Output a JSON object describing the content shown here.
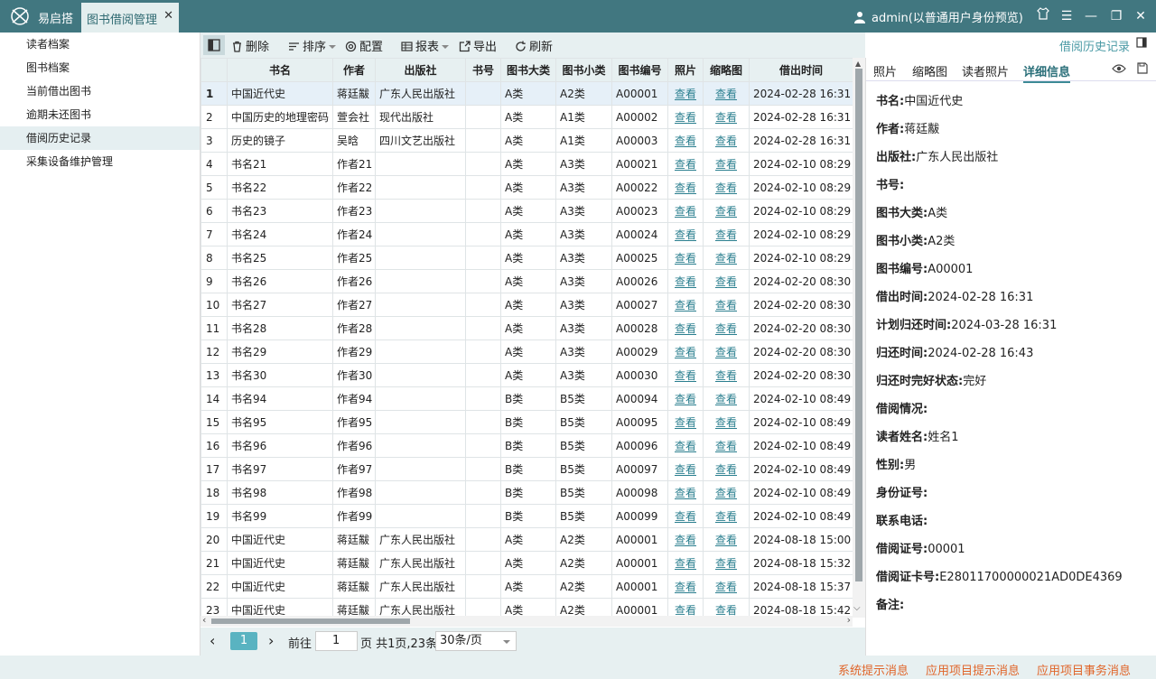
{
  "app": {
    "name": "易启搭",
    "active_tab": "图书借阅管理",
    "user": "admin(以普通用户身份预览)"
  },
  "sidebar": {
    "items": [
      {
        "label": "读者档案"
      },
      {
        "label": "图书档案"
      },
      {
        "label": "当前借出图书"
      },
      {
        "label": "逾期未还图书"
      },
      {
        "label": "借阅历史记录"
      },
      {
        "label": "采集设备维护管理"
      }
    ]
  },
  "toolbar": {
    "delete": "删除",
    "sort": "排序",
    "config": "配置",
    "report": "报表",
    "export": "导出",
    "refresh": "刷新",
    "title": "借阅历史记录"
  },
  "table": {
    "headers": [
      "书名",
      "作者",
      "出版社",
      "书号",
      "图书大类",
      "图书小类",
      "图书编号",
      "照片",
      "缩略图",
      "借出时间"
    ],
    "link_label": "查看",
    "rows": [
      [
        "1",
        "中国近代史",
        "蒋廷黻",
        "广东人民出版社",
        "",
        "A类",
        "A2类",
        "A00001",
        "2024-02-28 16:31"
      ],
      [
        "2",
        "中国历史的地理密码",
        "萱会社",
        "现代出版社",
        "",
        "A类",
        "A1类",
        "A00002",
        "2024-02-28 16:31"
      ],
      [
        "3",
        "历史的镜子",
        "吴晗",
        "四川文艺出版社",
        "",
        "A类",
        "A1类",
        "A00003",
        "2024-02-28 16:31"
      ],
      [
        "4",
        "书名21",
        "作者21",
        "",
        "",
        "A类",
        "A3类",
        "A00021",
        "2024-02-10 08:29"
      ],
      [
        "5",
        "书名22",
        "作者22",
        "",
        "",
        "A类",
        "A3类",
        "A00022",
        "2024-02-10 08:29"
      ],
      [
        "6",
        "书名23",
        "作者23",
        "",
        "",
        "A类",
        "A3类",
        "A00023",
        "2024-02-10 08:29"
      ],
      [
        "7",
        "书名24",
        "作者24",
        "",
        "",
        "A类",
        "A3类",
        "A00024",
        "2024-02-10 08:29"
      ],
      [
        "8",
        "书名25",
        "作者25",
        "",
        "",
        "A类",
        "A3类",
        "A00025",
        "2024-02-10 08:29"
      ],
      [
        "9",
        "书名26",
        "作者26",
        "",
        "",
        "A类",
        "A3类",
        "A00026",
        "2024-02-20 08:30"
      ],
      [
        "10",
        "书名27",
        "作者27",
        "",
        "",
        "A类",
        "A3类",
        "A00027",
        "2024-02-20 08:30"
      ],
      [
        "11",
        "书名28",
        "作者28",
        "",
        "",
        "A类",
        "A3类",
        "A00028",
        "2024-02-20 08:30"
      ],
      [
        "12",
        "书名29",
        "作者29",
        "",
        "",
        "A类",
        "A3类",
        "A00029",
        "2024-02-20 08:30"
      ],
      [
        "13",
        "书名30",
        "作者30",
        "",
        "",
        "A类",
        "A3类",
        "A00030",
        "2024-02-20 08:30"
      ],
      [
        "14",
        "书名94",
        "作者94",
        "",
        "",
        "B类",
        "B5类",
        "A00094",
        "2024-02-10 08:49"
      ],
      [
        "15",
        "书名95",
        "作者95",
        "",
        "",
        "B类",
        "B5类",
        "A00095",
        "2024-02-10 08:49"
      ],
      [
        "16",
        "书名96",
        "作者96",
        "",
        "",
        "B类",
        "B5类",
        "A00096",
        "2024-02-10 08:49"
      ],
      [
        "17",
        "书名97",
        "作者97",
        "",
        "",
        "B类",
        "B5类",
        "A00097",
        "2024-02-10 08:49"
      ],
      [
        "18",
        "书名98",
        "作者98",
        "",
        "",
        "B类",
        "B5类",
        "A00098",
        "2024-02-10 08:49"
      ],
      [
        "19",
        "书名99",
        "作者99",
        "",
        "",
        "B类",
        "B5类",
        "A00099",
        "2024-02-10 08:49"
      ],
      [
        "20",
        "中国近代史",
        "蒋廷黻",
        "广东人民出版社",
        "",
        "A类",
        "A2类",
        "A00001",
        "2024-08-18 15:00"
      ],
      [
        "21",
        "中国近代史",
        "蒋廷黻",
        "广东人民出版社",
        "",
        "A类",
        "A2类",
        "A00001",
        "2024-08-18 15:32"
      ],
      [
        "22",
        "中国近代史",
        "蒋廷黻",
        "广东人民出版社",
        "",
        "A类",
        "A2类",
        "A00001",
        "2024-08-18 15:37"
      ],
      [
        "23",
        "中国近代史",
        "蒋廷黻",
        "广东人民出版社",
        "",
        "A类",
        "A2类",
        "A00001",
        "2024-08-18 15:42"
      ]
    ]
  },
  "pager": {
    "current": "1",
    "goto_label": "前往",
    "goto_value": "1",
    "summary": "页 共1页,23条",
    "page_size": "30条/页"
  },
  "right_panel": {
    "tabs": [
      "照片",
      "缩略图",
      "读者照片",
      "详细信息"
    ],
    "details": [
      {
        "k": "书名:",
        "v": "中国近代史"
      },
      {
        "k": "作者:",
        "v": "蒋廷黻"
      },
      {
        "k": "出版社:",
        "v": "广东人民出版社"
      },
      {
        "k": "书号:",
        "v": ""
      },
      {
        "k": "图书大类:",
        "v": "A类"
      },
      {
        "k": "图书小类:",
        "v": "A2类"
      },
      {
        "k": "图书编号:",
        "v": "A00001"
      },
      {
        "k": "借出时间:",
        "v": "2024-02-28 16:31"
      },
      {
        "k": "计划归还时间:",
        "v": "2024-03-28 16:31"
      },
      {
        "k": "归还时间:",
        "v": "2024-02-28 16:43"
      },
      {
        "k": "归还时完好状态:",
        "v": "完好"
      },
      {
        "k": "借阅情况:",
        "v": ""
      },
      {
        "k": "读者姓名:",
        "v": "姓名1"
      },
      {
        "k": "性别:",
        "v": "男"
      },
      {
        "k": "身份证号:",
        "v": ""
      },
      {
        "k": "联系电话:",
        "v": ""
      },
      {
        "k": "借阅证号:",
        "v": "00001"
      },
      {
        "k": "借阅证卡号:",
        "v": "E28011700000021AD0DE4369"
      },
      {
        "k": "备注:",
        "v": ""
      }
    ]
  },
  "statusbar": {
    "items": [
      "系统提示消息",
      "应用项目提示消息",
      "应用项目事务消息"
    ]
  },
  "colors": {
    "accent": "#417780",
    "link": "#2b7f8f",
    "status": "#e0652a",
    "selected_row": "#e6f0f8"
  }
}
